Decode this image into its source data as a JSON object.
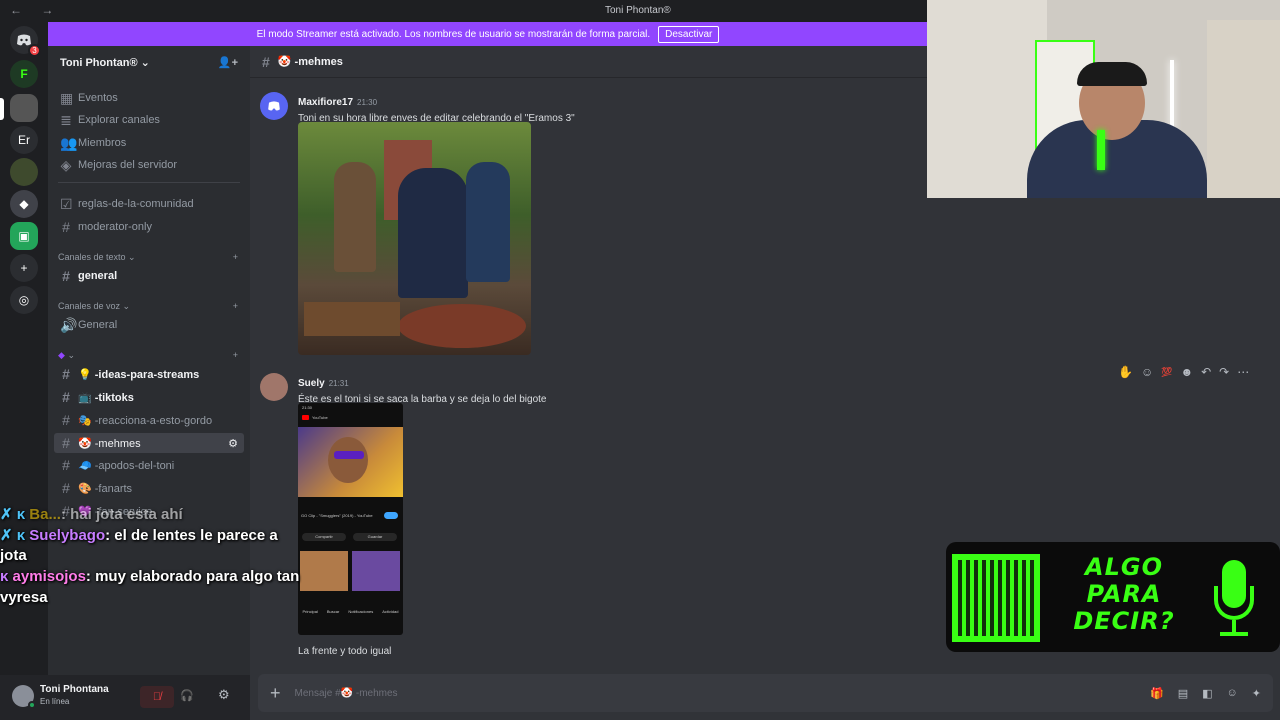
{
  "titlebar": {
    "back": "←",
    "forward": "→",
    "title": "Toni Phontan®"
  },
  "servers": [
    {
      "label": "",
      "badge": "3"
    },
    {
      "label": ""
    },
    {
      "label": ""
    },
    {
      "label": "Er"
    },
    {
      "label": ""
    },
    {
      "label": ""
    },
    {
      "label": ""
    },
    {
      "label": "+"
    },
    {
      "label": ""
    }
  ],
  "banner": {
    "text": "El modo Streamer está activado. Los nombres de usuario se mostrarán de forma parcial.",
    "button": "Desactivar"
  },
  "guild": {
    "name": "Toni Phontan® ⌄"
  },
  "nav_items": [
    {
      "label": "Eventos"
    },
    {
      "label": "Explorar canales"
    },
    {
      "label": "Miembros"
    },
    {
      "label": "Mejoras del servidor"
    }
  ],
  "channels_top": [
    {
      "label": "reglas-de-la-comunidad"
    },
    {
      "label": "moderator-only"
    }
  ],
  "categories": {
    "text": "Canales de texto ⌄",
    "voice": "Canales de voz ⌄",
    "third": "⌄"
  },
  "text_channels": [
    {
      "label": "general"
    }
  ],
  "voice_channels": [
    {
      "label": "General"
    }
  ],
  "third_channels": [
    {
      "label": "💡 -ideas-para-streams"
    },
    {
      "label": "📺 -tiktoks"
    },
    {
      "label": "🎭 -reacciona-a-esto-gordo"
    },
    {
      "label": "🤡 -mehmes"
    },
    {
      "label": "🧢 -apodos-del-toni"
    },
    {
      "label": "🎨 -fanarts"
    },
    {
      "label": "💜 -fan-service"
    }
  ],
  "channel_header": {
    "name": "🤡 -mehmes"
  },
  "messages": [
    {
      "author": "Maxifiore17",
      "time": "21:30",
      "text": "Toni en su hora libre enves de editar celebrando el \"Eramos 3\""
    },
    {
      "author": "Suely",
      "time": "21:31",
      "text": "Éste es el toni si se saca la barba y se deja lo del bigote",
      "followup": "La frente y todo igual"
    }
  ],
  "embedded_phone": {
    "status_time": "21:30",
    "app": "YouTube",
    "video_title": "GO Clip - \"Smugglers\" (2019) - YouTube",
    "btn1": "Compartir",
    "btn2": "Guardar",
    "nav": [
      "Principal",
      "Buscar",
      "Notificaciones",
      "Actividad"
    ]
  },
  "composer": {
    "placeholder": "Mensaje #🤡 -mehmes"
  },
  "user": {
    "name": "Toni Phontana",
    "status": "En línea"
  },
  "overlay_chat": [
    {
      "user": "Ba...",
      "text": ": hai jota esta ahí"
    },
    {
      "user": "Suelybago",
      "text": ": el de lentes le parece a"
    },
    {
      "user": "",
      "text": "jota"
    },
    {
      "user": "aymisojos",
      "text": ": muy elaborado para algo tan"
    },
    {
      "user": "",
      "text": "vyresa"
    }
  ],
  "qr_panel": {
    "line1": "ALGO",
    "line2": "PARA",
    "line3": "DECIR?"
  },
  "colors": {
    "accent": "#9146ff",
    "green": "#39ff14",
    "bg_main": "#313338",
    "bg_side": "#2b2d31"
  }
}
